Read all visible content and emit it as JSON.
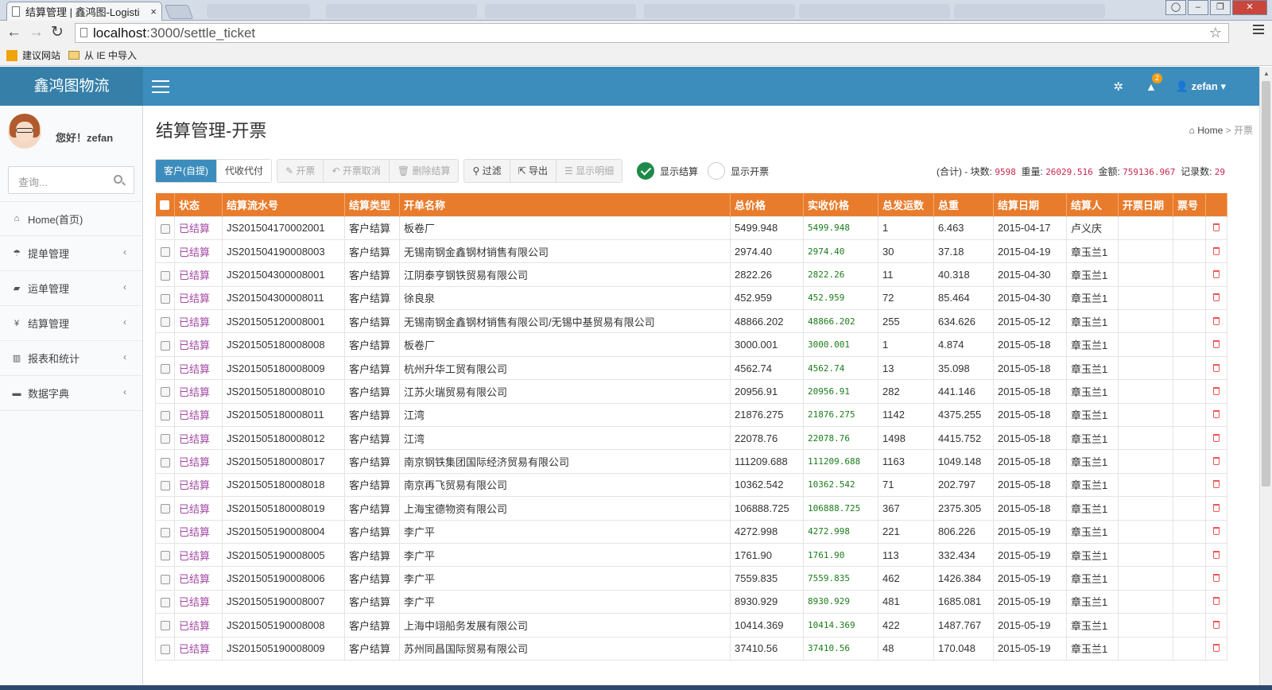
{
  "browser": {
    "tab_title": "结算管理 | 鑫鸿图-Logisti",
    "tab_close": "×",
    "url_host": "localhost",
    "url_path": ":3000/settle_ticket",
    "bookmarks": [
      "建议网站",
      "从 IE 中导入"
    ]
  },
  "header": {
    "logo": "鑫鸿图物流",
    "alert_count": "2",
    "user": "zefan ▾"
  },
  "sidebar": {
    "greeting": "您好！zefan",
    "search_placeholder": "查询...",
    "items": [
      {
        "icon": "home-icon",
        "glyph": "⌂",
        "label": "Home(首页)"
      },
      {
        "icon": "umbrella-icon",
        "glyph": "☂",
        "label": "提单管理",
        "arrow": "‹"
      },
      {
        "icon": "truck-icon",
        "glyph": "▰",
        "label": "运单管理",
        "arrow": "‹"
      },
      {
        "icon": "yen-icon",
        "glyph": "¥",
        "label": "结算管理",
        "arrow": "‹"
      },
      {
        "icon": "bar-chart-icon",
        "glyph": "▥",
        "label": "报表和统计",
        "arrow": "‹"
      },
      {
        "icon": "folder-icon",
        "glyph": "▬",
        "label": "数据字典",
        "arrow": "‹"
      }
    ]
  },
  "page": {
    "title": "结算管理-开票",
    "breadcrumb_home": "Home",
    "breadcrumb_sep": ">",
    "breadcrumb_current": "开票"
  },
  "toolbar": {
    "tab_customer": "客户(自提)",
    "tab_agent": "代收代付",
    "invoice": "开票",
    "cancel_invoice": "开票取消",
    "delete_settle": "删除结算",
    "filter": "过滤",
    "export": "导出",
    "show_detail": "显示明细",
    "radio_settle": "显示结算",
    "radio_invoice": "显示开票"
  },
  "summary": {
    "label_total": "(合计) - 块数:",
    "pieces": "9598",
    "label_weight": "重量:",
    "weight": "26029.516",
    "label_amount": "金额:",
    "amount": "759136.967",
    "label_records": "记录数:",
    "records": "29"
  },
  "table": {
    "columns": [
      "状态",
      "结算流水号",
      "结算类型",
      "开单名称",
      "总价格",
      "实收价格",
      "总发运数",
      "总重",
      "结算日期",
      "结算人",
      "开票日期",
      "票号"
    ],
    "rows": [
      [
        "已结算",
        "JS201504170002001",
        "客户结算",
        "板卷厂",
        "5499.948",
        "5499.948",
        "1",
        "6.463",
        "2015-04-17",
        "卢义庆",
        "",
        ""
      ],
      [
        "已结算",
        "JS201504190008003",
        "客户结算",
        "无锡南钢金鑫钢材销售有限公司",
        "2974.40",
        "2974.40",
        "30",
        "37.18",
        "2015-04-19",
        "章玉兰1",
        "",
        ""
      ],
      [
        "已结算",
        "JS201504300008001",
        "客户结算",
        "江阴泰亨钢铁贸易有限公司",
        "2822.26",
        "2822.26",
        "11",
        "40.318",
        "2015-04-30",
        "章玉兰1",
        "",
        ""
      ],
      [
        "已结算",
        "JS201504300008011",
        "客户结算",
        "徐良泉",
        "452.959",
        "452.959",
        "72",
        "85.464",
        "2015-04-30",
        "章玉兰1",
        "",
        ""
      ],
      [
        "已结算",
        "JS201505120008001",
        "客户结算",
        "无锡南钢金鑫钢材销售有限公司/无锡中基贸易有限公司",
        "48866.202",
        "48866.202",
        "255",
        "634.626",
        "2015-05-12",
        "章玉兰1",
        "",
        ""
      ],
      [
        "已结算",
        "JS201505180008008",
        "客户结算",
        "板卷厂",
        "3000.001",
        "3000.001",
        "1",
        "4.874",
        "2015-05-18",
        "章玉兰1",
        "",
        ""
      ],
      [
        "已结算",
        "JS201505180008009",
        "客户结算",
        "杭州升华工贸有限公司",
        "4562.74",
        "4562.74",
        "13",
        "35.098",
        "2015-05-18",
        "章玉兰1",
        "",
        ""
      ],
      [
        "已结算",
        "JS201505180008010",
        "客户结算",
        "江苏火瑞贸易有限公司",
        "20956.91",
        "20956.91",
        "282",
        "441.146",
        "2015-05-18",
        "章玉兰1",
        "",
        ""
      ],
      [
        "已结算",
        "JS201505180008011",
        "客户结算",
        "江湾",
        "21876.275",
        "21876.275",
        "1142",
        "4375.255",
        "2015-05-18",
        "章玉兰1",
        "",
        ""
      ],
      [
        "已结算",
        "JS201505180008012",
        "客户结算",
        "江湾",
        "22078.76",
        "22078.76",
        "1498",
        "4415.752",
        "2015-05-18",
        "章玉兰1",
        "",
        ""
      ],
      [
        "已结算",
        "JS201505180008017",
        "客户结算",
        "南京钢铁集团国际经济贸易有限公司",
        "111209.688",
        "111209.688",
        "1163",
        "1049.148",
        "2015-05-18",
        "章玉兰1",
        "",
        ""
      ],
      [
        "已结算",
        "JS201505180008018",
        "客户结算",
        "南京再飞贸易有限公司",
        "10362.542",
        "10362.542",
        "71",
        "202.797",
        "2015-05-18",
        "章玉兰1",
        "",
        ""
      ],
      [
        "已结算",
        "JS201505180008019",
        "客户结算",
        "上海宝德物资有限公司",
        "106888.725",
        "106888.725",
        "367",
        "2375.305",
        "2015-05-18",
        "章玉兰1",
        "",
        ""
      ],
      [
        "已结算",
        "JS201505190008004",
        "客户结算",
        "李广平",
        "4272.998",
        "4272.998",
        "221",
        "806.226",
        "2015-05-19",
        "章玉兰1",
        "",
        ""
      ],
      [
        "已结算",
        "JS201505190008005",
        "客户结算",
        "李广平",
        "1761.90",
        "1761.90",
        "113",
        "332.434",
        "2015-05-19",
        "章玉兰1",
        "",
        ""
      ],
      [
        "已结算",
        "JS201505190008006",
        "客户结算",
        "李广平",
        "7559.835",
        "7559.835",
        "462",
        "1426.384",
        "2015-05-19",
        "章玉兰1",
        "",
        ""
      ],
      [
        "已结算",
        "JS201505190008007",
        "客户结算",
        "李广平",
        "8930.929",
        "8930.929",
        "481",
        "1685.081",
        "2015-05-19",
        "章玉兰1",
        "",
        ""
      ],
      [
        "已结算",
        "JS201505190008008",
        "客户结算",
        "上海中翊船务发展有限公司",
        "10414.369",
        "10414.369",
        "422",
        "1487.767",
        "2015-05-19",
        "章玉兰1",
        "",
        ""
      ],
      [
        "已结算",
        "JS201505190008009",
        "客户结算",
        "苏州同昌国际贸易有限公司",
        "37410.56",
        "37410.56",
        "48",
        "170.048",
        "2015-05-19",
        "章玉兰1",
        "",
        ""
      ]
    ]
  }
}
